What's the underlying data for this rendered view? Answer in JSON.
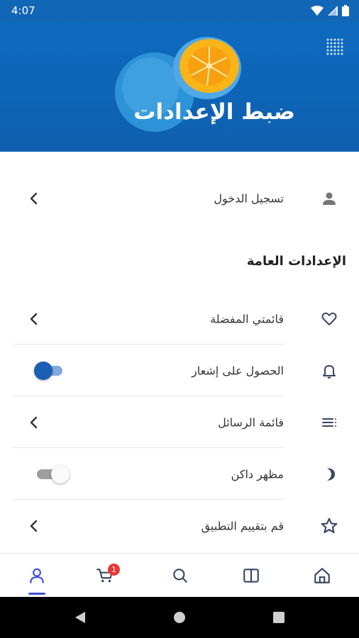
{
  "status_bar": {
    "time": "4:07"
  },
  "header": {
    "title": "ضبط الإعدادات"
  },
  "login": {
    "label": "تسجيل الدخول"
  },
  "general_section": {
    "title": "الإعدادات العامة",
    "items": [
      {
        "label": "قائمتي المفضلة",
        "icon": "heart-icon",
        "control": "chevron"
      },
      {
        "label": "الحصول على إشعار",
        "icon": "bell-icon",
        "control": "toggle",
        "on": true
      },
      {
        "label": "قائمة الرسائل",
        "icon": "list-icon",
        "control": "chevron"
      },
      {
        "label": "مظهر داكن",
        "icon": "moon-icon",
        "control": "toggle",
        "on": false
      },
      {
        "label": "قم بتقييم التطبيق",
        "icon": "star-icon",
        "control": "chevron"
      }
    ]
  },
  "bottom_nav": {
    "items": [
      "home-icon",
      "book-icon",
      "search-icon",
      "cart-icon",
      "user-icon"
    ],
    "cart_badge": "1",
    "active": "user-icon"
  },
  "colors": {
    "header_blue": "#0f66b8",
    "accent": "#3f51d6",
    "toggle_on": "#1a5fb4",
    "badge": "#e53935"
  }
}
